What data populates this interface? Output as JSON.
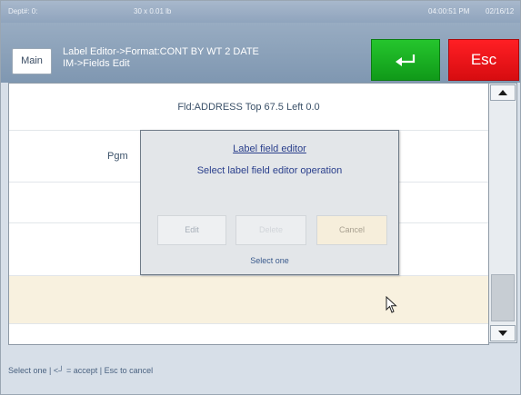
{
  "statusbar": {
    "dept": "Dept#: 0:",
    "weight": "30 x 0.01 lb",
    "time": "04:00:51 PM",
    "date": "02/16/12"
  },
  "header": {
    "main_label": "Main",
    "title_line1": "Label Editor->Format:CONT BY WT 2 DATE",
    "title_line2": "IM->Fields Edit",
    "enter_icon": "enter-arrow-icon",
    "esc_label": "Esc"
  },
  "list": {
    "rows": [
      {
        "text": "Fld:ADDRESS Top 67.5 Left 0.0"
      },
      {
        "text": "Pgm"
      },
      {
        "text": ""
      },
      {
        "text": ""
      },
      {
        "text": ""
      },
      {
        "text": ""
      }
    ]
  },
  "dialog": {
    "title": "Label field editor",
    "message": "Select label field editor operation",
    "edit_label": "Edit",
    "delete_label": "Delete",
    "cancel_label": "Cancel",
    "footer": "Select one"
  },
  "hint": "Select one | <┘ = accept | Esc to cancel",
  "colors": {
    "enter_button": "#17b020",
    "esc_button": "#e81418",
    "highlight_row": "#f8f1df",
    "header_bg": "#8ea3bc"
  }
}
